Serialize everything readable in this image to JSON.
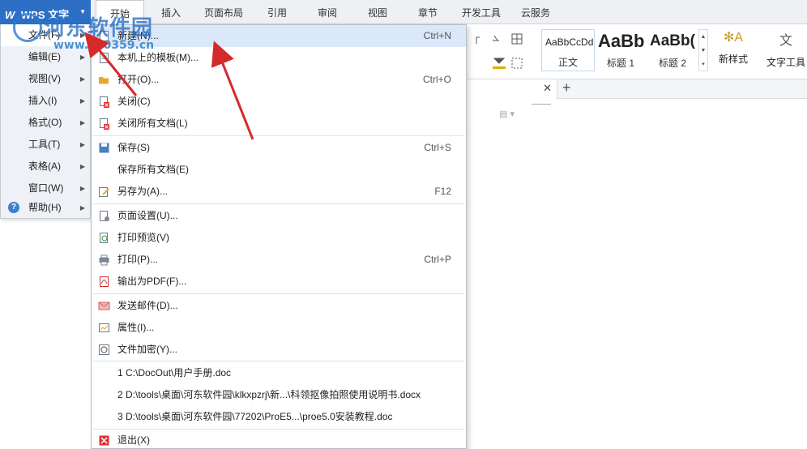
{
  "app": {
    "logo": "W",
    "title": "WPS 文字"
  },
  "tabs": [
    "开始",
    "插入",
    "页面布局",
    "引用",
    "审阅",
    "视图",
    "章节",
    "开发工具",
    "云服务"
  ],
  "styles": [
    {
      "sample": "AaBbCcDd",
      "label": "正文"
    },
    {
      "sample": "AaBb",
      "label": "标题 1"
    },
    {
      "sample": "AaBb(",
      "label": "标题 2"
    }
  ],
  "ribbon_buttons": {
    "new_style": "新样式",
    "text_tools": "文字工具"
  },
  "left_menu": [
    {
      "label": "文件(F)"
    },
    {
      "label": "编辑(E)"
    },
    {
      "label": "视图(V)"
    },
    {
      "label": "插入(I)"
    },
    {
      "label": "格式(O)"
    },
    {
      "label": "工具(T)"
    },
    {
      "label": "表格(A)"
    },
    {
      "label": "窗口(W)"
    },
    {
      "label": "帮助(H)"
    }
  ],
  "file_menu": {
    "new": {
      "label": "新建(N)...",
      "shortcut": "Ctrl+N"
    },
    "templates": {
      "label": "本机上的模板(M)..."
    },
    "open": {
      "label": "打开(O)...",
      "shortcut": "Ctrl+O"
    },
    "close": {
      "label": "关闭(C)"
    },
    "close_all": {
      "label": "关闭所有文档(L)"
    },
    "save": {
      "label": "保存(S)",
      "shortcut": "Ctrl+S"
    },
    "save_all": {
      "label": "保存所有文档(E)"
    },
    "save_as": {
      "label": "另存为(A)...",
      "shortcut": "F12"
    },
    "page_setup": {
      "label": "页面设置(U)..."
    },
    "print_preview": {
      "label": "打印预览(V)"
    },
    "print": {
      "label": "打印(P)...",
      "shortcut": "Ctrl+P"
    },
    "export_pdf": {
      "label": "输出为PDF(F)..."
    },
    "send_mail": {
      "label": "发送邮件(D)..."
    },
    "properties": {
      "label": "属性(I)..."
    },
    "encrypt": {
      "label": "文件加密(Y)..."
    },
    "recent": [
      "1 C:\\DocOut\\用户手册.doc",
      "2 D:\\tools\\桌面\\河东软件园\\klkxpzrj\\新...\\科领抠像拍照使用说明书.docx",
      "3 D:\\tools\\桌面\\河东软件园\\77202\\ProE5...\\proe5.0安装教程.doc"
    ],
    "exit": {
      "label": "退出(X)"
    }
  },
  "watermark": {
    "title": "河东软件园",
    "url": "www.pc0359.cn"
  },
  "colors": {
    "accent": "#2d6fc4",
    "highlight": "#dbe8f9",
    "arrow": "#d42a2a"
  }
}
